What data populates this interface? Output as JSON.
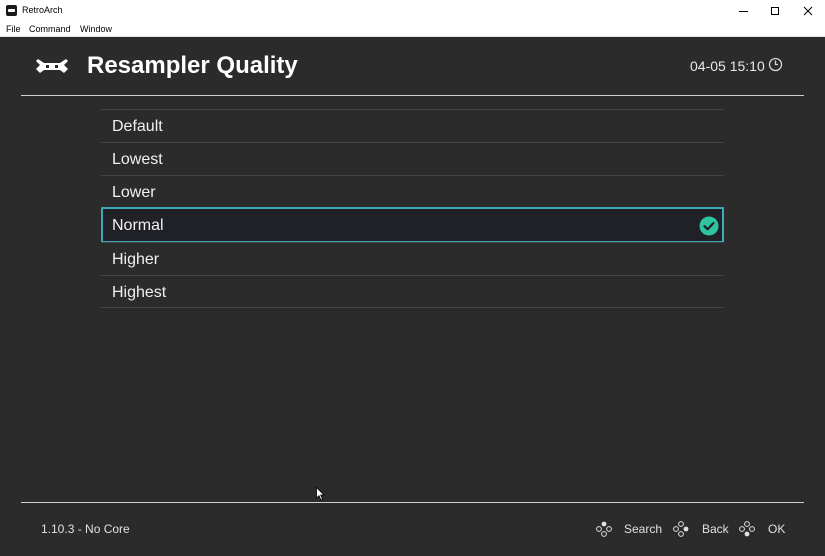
{
  "window": {
    "title": "RetroArch"
  },
  "menubar": {
    "items": [
      "File",
      "Command",
      "Window"
    ]
  },
  "header": {
    "title": "Resampler Quality",
    "clock": "04-05 15:10"
  },
  "list": {
    "items": [
      {
        "label": "Default",
        "selected": false
      },
      {
        "label": "Lowest",
        "selected": false
      },
      {
        "label": "Lower",
        "selected": false
      },
      {
        "label": "Normal",
        "selected": true
      },
      {
        "label": "Higher",
        "selected": false
      },
      {
        "label": "Highest",
        "selected": false
      }
    ]
  },
  "footer": {
    "version": "1.10.3 - No Core",
    "actions": {
      "search": "Search",
      "back": "Back",
      "ok": "OK"
    }
  },
  "colors": {
    "background": "#2b2b2b",
    "selection_border": "#3ea9bb",
    "check": "#2ec4a0"
  }
}
